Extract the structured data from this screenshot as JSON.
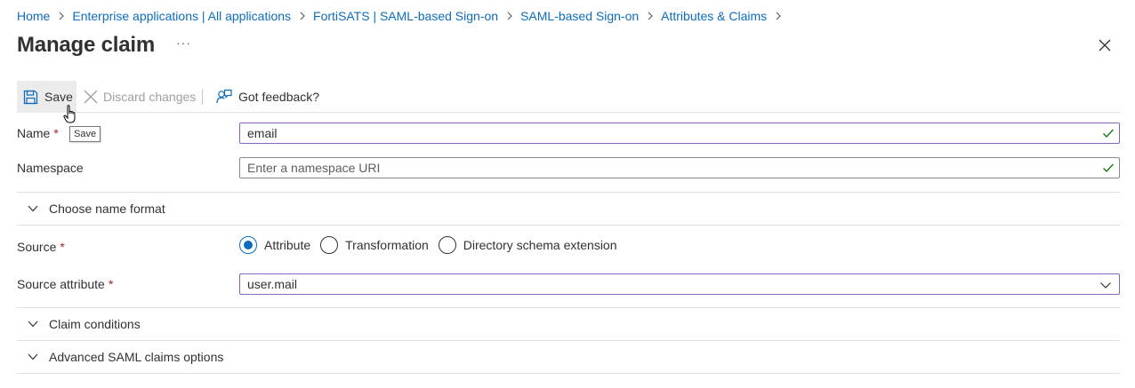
{
  "breadcrumb": [
    {
      "label": "Home"
    },
    {
      "label": "Enterprise applications | All applications"
    },
    {
      "label": "FortiSATS | SAML-based Sign-on"
    },
    {
      "label": "SAML-based Sign-on"
    },
    {
      "label": "Attributes & Claims"
    }
  ],
  "page": {
    "title": "Manage claim",
    "more_label": "···"
  },
  "toolbar": {
    "save_label": "Save",
    "discard_label": "Discard changes",
    "feedback_label": "Got feedback?",
    "save_tooltip": "Save"
  },
  "form": {
    "name": {
      "label": "Name",
      "required_mark": "*",
      "value": "email"
    },
    "namespace": {
      "label": "Namespace",
      "value": "",
      "placeholder": "Enter a namespace URI"
    },
    "name_format_section": "Choose name format",
    "source": {
      "label": "Source",
      "required_mark": "*",
      "options": [
        "Attribute",
        "Transformation",
        "Directory schema extension"
      ],
      "selected": "Attribute"
    },
    "source_attribute": {
      "label": "Source attribute",
      "required_mark": "*",
      "value": "user.mail"
    },
    "claim_conditions_section": "Claim conditions",
    "advanced_section": "Advanced SAML claims options"
  },
  "colors": {
    "link": "#0f6cbd",
    "focus_border": "#8764b8",
    "valid_check": "#107c10",
    "required": "#a4262c"
  }
}
